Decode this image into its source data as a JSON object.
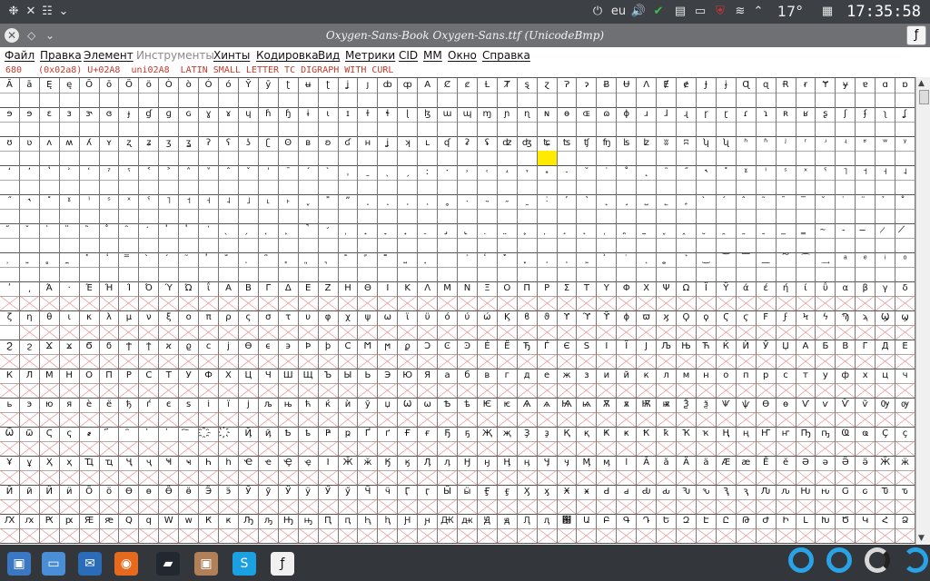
{
  "top_panel": {
    "layout": "eu",
    "temperature": "17°",
    "clock": "17:35:58"
  },
  "window": {
    "title": "Oxygen-Sans-Book Oxygen-Sans.ttf (UnicodeBmp)"
  },
  "menu": {
    "items": [
      "Файл",
      "Правка",
      "Элемент",
      "Инструменты",
      "Хинты",
      "Кодировка",
      "Вид",
      "Метрики",
      "CID",
      "MM",
      "Окно",
      "Справка"
    ],
    "disabled": [
      "Инструменты"
    ]
  },
  "info": {
    "text": "680   (0x02a8) U+02A8  uni02A8  LATIN SMALL LETTER TC DIGRAPH WITH CURL"
  },
  "grid": {
    "columns": 46,
    "selected": {
      "row": 2,
      "col": 27
    },
    "rows": [
      [
        "Ā",
        "ā",
        "Ę",
        "ę",
        "Ō",
        "ō",
        "Ö",
        "ö",
        "Ò",
        "ò",
        "Ó",
        "ó",
        "Ȳ",
        "ȳ",
        "ʈ",
        "ʉ",
        "ʈ",
        "ʝ",
        "ȷ",
        "ȸ",
        "ȹ",
        "A",
        "Ȼ",
        "ȼ",
        "Ƚ",
        "Ⱦ",
        "ȿ",
        "ɀ",
        "Ɂ",
        "ɂ",
        "Ƀ",
        "Ʉ",
        "Ʌ",
        "Ɇ",
        "ɇ",
        "Ɉ",
        "ɉ",
        "Ɋ",
        "ɋ",
        "Ɍ",
        "ɍ",
        "Ɏ",
        "ɏ",
        "ɐ",
        "ɑ",
        "ɒ"
      ],
      [
        "ɘ",
        "ɘ",
        "ɛ",
        "ɜ",
        "ɝ",
        "ɞ",
        "ɟ",
        "ɠ",
        "ɡ",
        "ɢ",
        "ɣ",
        "ɤ",
        "ɥ",
        "ɦ",
        "ɧ",
        "ɨ",
        "ɩ",
        "ɪ",
        "ɫ",
        "ɬ",
        "ɭ",
        "ɮ",
        "ɯ",
        "ɰ",
        "ɱ",
        "ɲ",
        "ɳ",
        "ɴ",
        "ɵ",
        "ɶ",
        "ɷ",
        "ɸ",
        "ɹ",
        "ɺ",
        "ɻ",
        "ɼ",
        "ɽ",
        "ɾ",
        "ɿ",
        "ʀ",
        "ʁ",
        "ʂ",
        "ʃ",
        "ʄ",
        "ʅ",
        "ʆ"
      ],
      [
        "ʊ",
        "ʋ",
        "ʌ",
        "ʍ",
        "ʎ",
        "ʏ",
        "ʐ",
        "ʑ",
        "ʒ",
        "ʓ",
        "ʔ",
        "ʕ",
        "ʖ",
        "ʗ",
        "ʘ",
        "ʙ",
        "ʚ",
        "ʛ",
        "ʜ",
        "ʝ",
        "ʞ",
        "ʟ",
        "ʠ",
        "ʡ",
        "ʢ",
        "ʣ",
        "ʤ",
        "ʨ",
        "ʦ",
        "ʧ",
        "ʩ",
        "ʪ",
        "ʫ",
        "ʬ",
        "ʭ",
        "ʮ",
        "ʯ",
        "ʰ",
        "ʱ",
        "ʲ",
        "ʳ",
        "ʴ",
        "ʵ",
        "ʶ",
        "ʷ",
        "ʸ"
      ],
      [
        "ʻ",
        "ʼ",
        "ʽ",
        "ʾ",
        "ʿ",
        "ˀ",
        "ˁ",
        "˂",
        "˃",
        "˄",
        "˅",
        "ˆ",
        "ˇ",
        "ˈ",
        "ˉ",
        "ˊ",
        "ˋ",
        "ˌ",
        "ˍ",
        "ˎ",
        "ˏ",
        "ː",
        "ˑ",
        "˒",
        "˓",
        "˔",
        "˕",
        "˖",
        "˗",
        "˘",
        "˙",
        "˚",
        "˛",
        "˜",
        "˝",
        "˞",
        "˟",
        "ˠ",
        "ˡ",
        "ˢ",
        "ˣ",
        "ˤ",
        "˥",
        "˦",
        "˧",
        "˨"
      ],
      [
        "˝",
        "˞",
        "˟",
        "ˠ",
        "ˡ",
        "ˢ",
        "ˣ",
        "ˤ",
        "˥",
        "˦",
        "˧",
        "˨",
        "˩",
        "˪",
        "˫",
        "ˬ",
        "˭",
        "ˮ",
        "˯",
        "˰",
        "˱",
        "˲",
        "˳",
        "˴",
        "˵",
        "˶",
        "˷",
        "˸",
        "˹",
        "˺",
        "˻",
        "˼",
        "˽",
        "˾",
        "˿",
        "̀",
        "́",
        "̂",
        "̃",
        "̄",
        "̅",
        "̆",
        "̇",
        "̈",
        "̉",
        "̊"
      ],
      [
        "̋",
        "̌",
        "̍",
        "̎",
        "̏",
        "̐",
        "̑",
        "̒",
        "̓",
        "̔",
        "̕",
        "̖",
        "̗",
        "̘",
        "̙",
        "̚",
        "̛",
        "̜",
        "̝",
        "̞",
        "̟",
        "̠",
        "̡",
        "̢",
        "̣",
        "̤",
        "̥",
        "̦",
        "̧",
        "̨",
        "̩",
        "̪",
        "̫",
        "̬",
        "̭",
        "̮",
        "̯",
        "̰",
        "̱",
        "̲",
        "̳",
        "̴",
        "̵",
        "̶",
        "̷",
        "̸"
      ],
      [
        "̹",
        "̺",
        "̻",
        "̼",
        "̽",
        "̾",
        "̿",
        "̀",
        "́",
        "͂",
        "̓",
        "̈́",
        "ͅ",
        "͆",
        "͇",
        "͈",
        "͉",
        "͊",
        "͋",
        "͌",
        "͍",
        "͎",
        "͏",
        "͐",
        "͑",
        "͒",
        "͓",
        "͔",
        "͕",
        "͖",
        "͗",
        "͘",
        "͙",
        "͚",
        "͛",
        "͜",
        "͝",
        "͞",
        "͟",
        "͠",
        "͡",
        "͢",
        "ͣ",
        "ͤ",
        "ͥ",
        "ͦ"
      ],
      [
        "ʹ",
        "͵",
        "Ά",
        "·",
        "Έ",
        "Ή",
        "Ί",
        "Ό",
        "Ύ",
        "Ώ",
        "ΐ",
        "Α",
        "Β",
        "Γ",
        "Δ",
        "Ε",
        "Ζ",
        "Η",
        "Θ",
        "Ι",
        "Κ",
        "Λ",
        "Μ",
        "Ν",
        "Ξ",
        "Ο",
        "Π",
        "Ρ",
        "Σ",
        "Τ",
        "Υ",
        "Φ",
        "Χ",
        "Ψ",
        "Ω",
        "Ϊ",
        "Ϋ",
        "ά",
        "έ",
        "ή",
        "ί",
        "ΰ",
        "α",
        "β",
        "γ",
        "δ"
      ],
      [
        "ζ",
        "η",
        "θ",
        "ι",
        "κ",
        "λ",
        "μ",
        "ν",
        "ξ",
        "ο",
        "π",
        "ρ",
        "ς",
        "σ",
        "τ",
        "υ",
        "φ",
        "χ",
        "ψ",
        "ω",
        "ϊ",
        "ϋ",
        "ό",
        "ύ",
        "ώ",
        "Ϗ",
        "ϐ",
        "ϑ",
        "ϒ",
        "ϓ",
        "ϔ",
        "ϕ",
        "ϖ",
        "ϗ",
        "Ϙ",
        "ϙ",
        "Ϛ",
        "ϛ",
        "Ϝ",
        "ϝ",
        "Ϟ",
        "ϟ",
        "Ϡ",
        "ϡ",
        "Ϣ",
        "ϣ"
      ],
      [
        "Ϩ",
        "ϩ",
        "Ϫ",
        "ϫ",
        "Ϭ",
        "ϭ",
        "Ϯ",
        "ϯ",
        "ϰ",
        "ϱ",
        "ϲ",
        "ϳ",
        "ϴ",
        "ϵ",
        "϶",
        "Ϸ",
        "ϸ",
        "Ϲ",
        "Ϻ",
        "ϻ",
        "ϼ",
        "Ͻ",
        "Ͼ",
        "Ͽ",
        "Ѐ",
        "Ё",
        "Ђ",
        "Ѓ",
        "Є",
        "Ѕ",
        "І",
        "Ї",
        "Ј",
        "Љ",
        "Њ",
        "Ћ",
        "Ќ",
        "Ѝ",
        "Ў",
        "Џ",
        "А",
        "Б",
        "В",
        "Г",
        "Д",
        "Е"
      ],
      [
        "К",
        "Л",
        "М",
        "Н",
        "О",
        "П",
        "Р",
        "С",
        "Т",
        "У",
        "Ф",
        "Х",
        "Ц",
        "Ч",
        "Ш",
        "Щ",
        "Ъ",
        "Ы",
        "Ь",
        "Э",
        "Ю",
        "Я",
        "а",
        "б",
        "в",
        "г",
        "д",
        "е",
        "ж",
        "з",
        "и",
        "й",
        "к",
        "л",
        "м",
        "н",
        "о",
        "п",
        "р",
        "с",
        "т",
        "у",
        "ф",
        "х",
        "ц",
        "ч"
      ],
      [
        "ь",
        "э",
        "ю",
        "я",
        "ѐ",
        "ё",
        "ђ",
        "ѓ",
        "є",
        "ѕ",
        "і",
        "ї",
        "ј",
        "љ",
        "њ",
        "ћ",
        "ќ",
        "ѝ",
        "ў",
        "џ",
        "Ѡ",
        "ѡ",
        "Ѣ",
        "ѣ",
        "Ѥ",
        "ѥ",
        "Ѧ",
        "ѧ",
        "Ѩ",
        "ѩ",
        "Ѫ",
        "ѫ",
        "Ѭ",
        "ѭ",
        "Ѯ",
        "ѯ",
        "Ѱ",
        "ѱ",
        "Ѳ",
        "ѳ",
        "Ѵ",
        "ѵ",
        "Ѷ",
        "ѷ",
        "Ѹ",
        "ѹ"
      ],
      [
        "Ѿ",
        "ѿ",
        "Ҁ",
        "ҁ",
        "҂",
        "҃",
        "҄",
        "҅",
        "҆",
        "҇",
        "҈",
        "҉",
        "Ҋ",
        "ҋ",
        "Ҍ",
        "ҍ",
        "Ҏ",
        "ҏ",
        "Ґ",
        "ґ",
        "Ғ",
        "ғ",
        "Ҕ",
        "ҕ",
        "Җ",
        "җ",
        "Ҙ",
        "ҙ",
        "Қ",
        "қ",
        "Ҝ",
        "ҝ",
        "Ҟ",
        "ҟ",
        "Ҡ",
        "ҡ",
        "Ң",
        "ң",
        "Ҥ",
        "ҥ",
        "Ҧ",
        "ҧ",
        "Ҩ",
        "ҩ",
        "Ҫ",
        "ҫ"
      ],
      [
        "Ұ",
        "ұ",
        "Ҳ",
        "ҳ",
        "Ҵ",
        "ҵ",
        "Ҷ",
        "ҷ",
        "Ҹ",
        "ҹ",
        "Һ",
        "һ",
        "Ҽ",
        "ҽ",
        "Ҿ",
        "ҿ",
        "Ӏ",
        "Ӂ",
        "ӂ",
        "Ӄ",
        "ӄ",
        "Ӆ",
        "ӆ",
        "Ӈ",
        "ӈ",
        "Ӊ",
        "ӊ",
        "Ӌ",
        "ӌ",
        "Ӎ",
        "ӎ",
        "ӏ",
        "Ӑ",
        "ӑ",
        "Ӓ",
        "ӓ",
        "Ӕ",
        "ӕ",
        "Ӗ",
        "ӗ",
        "Ә",
        "ә",
        "Ӛ",
        "ӛ",
        "Ӝ",
        "ӝ"
      ],
      [
        "Ӣ",
        "ӣ",
        "Ӥ",
        "ӥ",
        "Ӧ",
        "ӧ",
        "Ө",
        "ө",
        "Ӫ",
        "ӫ",
        "Ӭ",
        "ӭ",
        "Ӯ",
        "ӯ",
        "Ӱ",
        "ӱ",
        "Ӳ",
        "ӳ",
        "Ӵ",
        "ӵ",
        "Ӷ",
        "ӷ",
        "Ӹ",
        "ӹ",
        "Ӻ",
        "ӻ",
        "Ӽ",
        "ӽ",
        "Ӿ",
        "ӿ",
        "Ԁ",
        "ԁ",
        "Ԃ",
        "ԃ",
        "Ԅ",
        "ԅ",
        "Ԇ",
        "ԇ",
        "Ԉ",
        "ԉ",
        "Ԋ",
        "ԋ",
        "Ԍ",
        "ԍ",
        "Ԏ",
        "ԏ"
      ],
      [
        "Ԕ",
        "ԕ",
        "Ԗ",
        "ԗ",
        "Ԙ",
        "ԙ",
        "Ԛ",
        "ԛ",
        "Ԝ",
        "ԝ",
        "Ԟ",
        "ԟ",
        "Ԡ",
        "ԡ",
        "Ԣ",
        "ԣ",
        "Ԥ",
        "ԥ",
        "Ԧ",
        "ԧ",
        "Ԩ",
        "ԩ",
        "Ԫ",
        "ԫ",
        "Ԭ",
        "ԭ",
        "Ԯ",
        "ԯ",
        "԰",
        "Ա",
        "Բ",
        "Գ",
        "Դ",
        "Ե",
        "Զ",
        "Է",
        "Ը",
        "Թ",
        "Ժ",
        "Ի",
        "Լ",
        "Խ",
        "Ծ",
        "Կ",
        "Հ",
        "Ձ"
      ]
    ],
    "filled_mask": [
      "1111111111111111111111111111111111111111111111",
      "1111111111111111111111111111111111111111111111",
      "1111111111111111111111111111111111111111111111",
      "1111111111111111111111111111111111111111111111",
      "1111111111111111111111111111111111111111111111",
      "1111111111111111111111111111111111111111111111",
      "1111111111111111111111111111111111111111111111",
      "0000000000000000000000000000000000000000000000",
      "1000000000000000000000000000000000000000000000",
      "0000000000000000000000000000000000000000000000",
      "0000000000000000000000000000000000000000000000",
      "0000000000000000000000000000000000000000000000",
      "0000000000000000000000000000000000000000000000",
      "0000000000000000000000000000000000000000000000",
      "0000000000000000000000000000000000000000000000",
      "0000000000000000000000000000000000000000000000"
    ]
  },
  "taskbar": {
    "icons": [
      "files-icon",
      "folder-icon",
      "mail-icon",
      "firefox-icon",
      "terminal-icon",
      "package-icon",
      "skype-icon",
      "fontforge-icon"
    ]
  }
}
